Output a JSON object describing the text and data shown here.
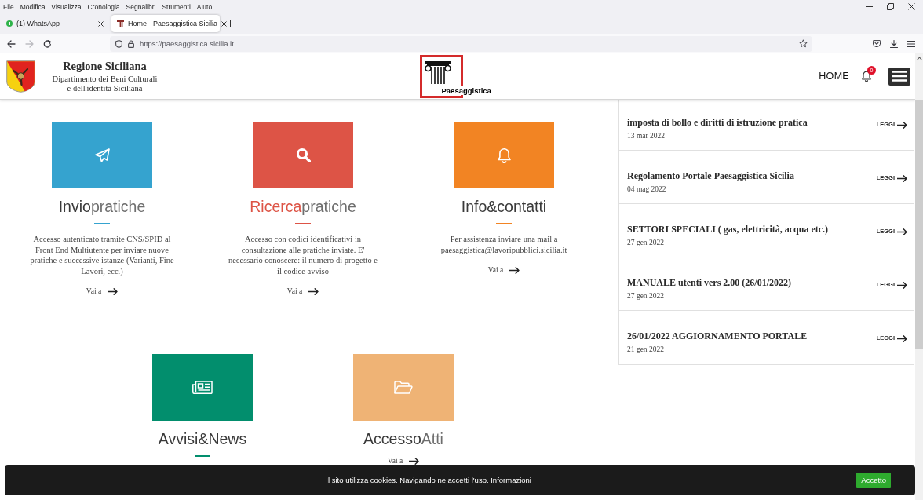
{
  "browser": {
    "menu_bar": [
      "File",
      "Modifica",
      "Visualizza",
      "Cronologia",
      "Segnalibri",
      "Strumenti",
      "Aiuto"
    ],
    "tabs": [
      {
        "kind": "chat",
        "title": "(1) WhatsApp",
        "selected": false
      },
      {
        "kind": "site",
        "title": "Home - Paesaggistica Sicilia",
        "selected": true
      }
    ],
    "nav_buttons": [
      {
        "kind": "back",
        "disabled": false
      },
      {
        "kind": "forward",
        "disabled": true
      },
      {
        "kind": "reload",
        "disabled": false
      }
    ],
    "address_bar": {
      "url": "https://paesaggistica.sicilia.it"
    }
  },
  "page": {
    "header": {
      "org_name": "Regione Siciliana",
      "org_subtitle": [
        "Dipartimento dei Beni Culturali",
        "e dell'identità Siciliana"
      ],
      "logo_text": "Paesaggistica",
      "nav_link": "HOME",
      "notification_count": "0"
    },
    "tile_rows": [
      {
        "tiles": [
          {
            "kind": "send",
            "color": "#35a3cf",
            "title": [
              {
                "text": "Invio",
                "kind": "strong"
              },
              {
                "text": "pratiche",
                "kind": "light"
              }
            ],
            "underline": true,
            "description": "Accesso autenticato tramite CNS/SPID al Front End Multiutente per inviare nuove pratiche e successive istanze (Varianti, Fine Lavori, ecc.)",
            "link": "Vai a"
          },
          {
            "kind": "search",
            "color": "#dd5446",
            "title": [
              {
                "text": "Ricerca",
                "kind": "accent"
              },
              {
                "text": "pratiche",
                "kind": "light"
              }
            ],
            "underline": true,
            "description": "Accesso con codici identificativi in consultazione alle pratiche inviate. E' necessario conoscere: il numero di progetto e il codice avviso",
            "link": "Vai a"
          },
          {
            "kind": "bell",
            "color": "#f28423",
            "title": [
              {
                "text": "Info&contatti",
                "kind": "strong"
              }
            ],
            "underline": true,
            "description": "Per assistenza inviare una mail a paesaggistica@lavoripubblici.sicilia.it",
            "link": "Vai a"
          }
        ]
      },
      {
        "tiles": [
          {
            "kind": "newspaper",
            "color": "#028e6d",
            "title": [
              {
                "text": "Avvisi&News",
                "kind": "strong"
              }
            ],
            "underline": true
          },
          {
            "kind": "folder",
            "color": "#efb375",
            "title": [
              {
                "text": "Accesso",
                "kind": "strong"
              },
              {
                "text": "Atti",
                "kind": "light"
              }
            ],
            "underline": false,
            "link": "Vai a"
          }
        ]
      }
    ],
    "news": [
      {
        "title": "imposta di bollo e diritti di istruzione pratica",
        "date": "13 mar 2022",
        "link": "LEGGI"
      },
      {
        "title": "Regolamento Portale Paesaggistica Sicilia",
        "date": "04 mag 2022",
        "link": "LEGGI"
      },
      {
        "title": "SETTORI SPECIALI ( gas, elettricità, acqua etc.)",
        "date": "27 gen 2022",
        "link": "LEGGI"
      },
      {
        "title": "MANUALE utenti vers 2.00 (26/01/2022)",
        "date": "27 gen 2022",
        "link": "LEGGI"
      },
      {
        "title": "26/01/2022 AGGIORNAMENTO PORTALE",
        "date": "21 gen 2022",
        "link": "LEGGI"
      }
    ],
    "cookie_banner": {
      "message": "Il sito utilizza cookies. Navigando ne accetti l'uso.",
      "link": "Informazioni",
      "button": "Accetto"
    }
  }
}
